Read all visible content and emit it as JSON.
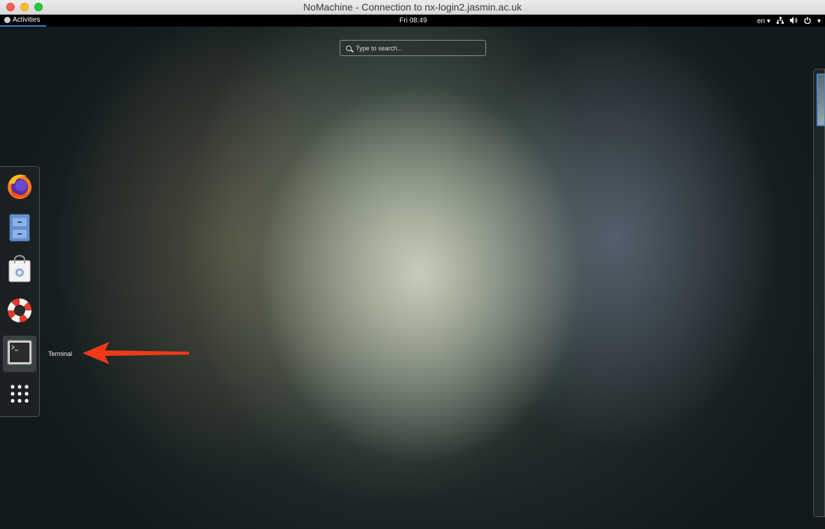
{
  "window": {
    "title": "NoMachine - Connection to nx-login2.jasmin.ac.uk"
  },
  "topbar": {
    "activities": "Activities",
    "clock": "Fri 08:49",
    "keyboard_layout": "en",
    "icons": [
      "network-icon",
      "volume-icon",
      "power-icon",
      "chevron-down-icon"
    ]
  },
  "search": {
    "placeholder": "Type to search..."
  },
  "dash": {
    "items": [
      {
        "name": "firefox",
        "icon": "firefox-icon"
      },
      {
        "name": "files",
        "icon": "filing-cabinet-icon"
      },
      {
        "name": "software",
        "icon": "shopping-bag-icon"
      },
      {
        "name": "help",
        "icon": "lifebuoy-icon"
      },
      {
        "name": "terminal",
        "icon": "terminal-icon",
        "active": true
      },
      {
        "name": "show-applications",
        "icon": "app-grid-icon"
      }
    ],
    "tooltip": "Terminal"
  },
  "colors": {
    "arrow": "#f03a17",
    "activities_underline": "#3f7fc8"
  }
}
